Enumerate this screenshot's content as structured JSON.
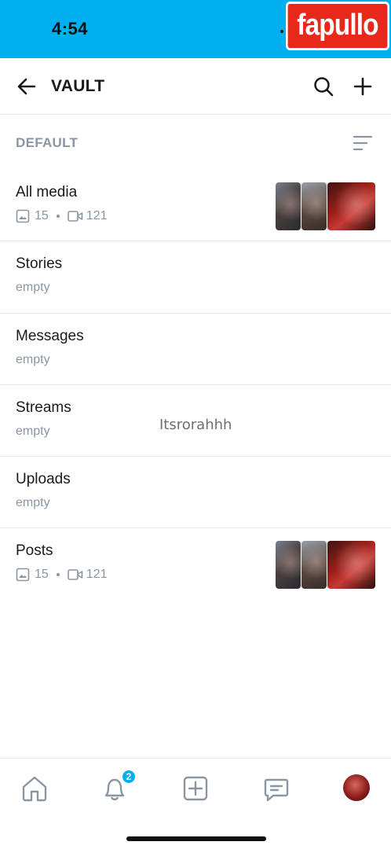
{
  "status_bar": {
    "time": "4:54",
    "color": "#00aff0"
  },
  "watermark": {
    "text": "fapullo"
  },
  "header": {
    "title": "VAULT",
    "back_icon": "arrow-left-icon",
    "search_icon": "search-icon",
    "add_icon": "plus-icon"
  },
  "section": {
    "label": "DEFAULT",
    "sort_icon": "sort-icon"
  },
  "items": [
    {
      "title": "All media",
      "photos": "15",
      "videos": "121",
      "sub": ""
    },
    {
      "title": "Stories",
      "sub": "empty"
    },
    {
      "title": "Messages",
      "sub": "empty"
    },
    {
      "title": "Streams",
      "sub": "empty"
    },
    {
      "title": "Uploads",
      "sub": "empty"
    },
    {
      "title": "Posts",
      "photos": "15",
      "videos": "121",
      "sub": ""
    }
  ],
  "overlay": {
    "text": "Itsrorahhh"
  },
  "bottom_nav": {
    "home_icon": "home-icon",
    "notifications_icon": "bell-icon",
    "notifications_badge": "2",
    "add_icon": "plus-square-icon",
    "messages_icon": "message-icon",
    "avatar": "avatar"
  },
  "colors": {
    "accent": "#00aff0",
    "muted": "#8a96a3",
    "divider": "#e6e8ea"
  }
}
